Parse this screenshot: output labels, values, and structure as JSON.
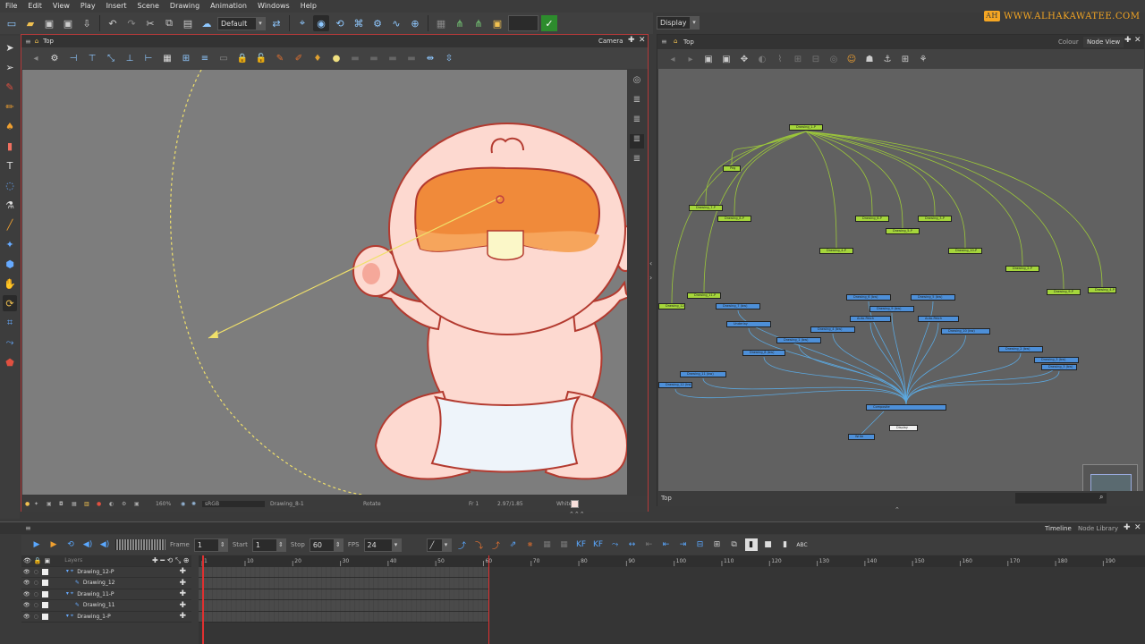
{
  "menu": [
    "File",
    "Edit",
    "View",
    "Play",
    "Insert",
    "Scene",
    "Drawing",
    "Animation",
    "Windows",
    "Help"
  ],
  "toolbar": {
    "workspace_combo": "Default",
    "display_combo": "Display"
  },
  "logo": {
    "text": "WWW.ALHAKAWATEE.COM",
    "icon": "AH"
  },
  "camera_view": {
    "tab_label": "Top",
    "view_name": "Camera",
    "status": {
      "zoom": "160%",
      "colorspace": "sRGB",
      "drawing": "Drawing_8-1",
      "tool": "Rotate",
      "frame": "Fr 1",
      "coords": "2.97/1.85",
      "bg": "White"
    }
  },
  "node_view": {
    "tab_label": "Top",
    "tabs": [
      "Colour",
      "Node View"
    ],
    "status_path": "Top",
    "nodes": [
      {
        "label": "Drawing_1-P",
        "type": "g"
      },
      {
        "label": "Peg",
        "type": "g"
      },
      {
        "label": "Drawing_7-P",
        "type": "g"
      },
      {
        "label": "Drawing_8-P",
        "type": "g"
      },
      {
        "label": "Drawing_6-P",
        "type": "g"
      },
      {
        "label": "Drawing_5-P",
        "type": "g"
      },
      {
        "label": "Drawing_3-P",
        "type": "g"
      },
      {
        "label": "Drawing_4-P",
        "type": "g"
      },
      {
        "label": "Drawing_10-P",
        "type": "g"
      },
      {
        "label": "Drawing_2-P",
        "type": "g"
      },
      {
        "label": "Drawing_11-P",
        "type": "g"
      },
      {
        "label": "Drawing_12-P",
        "type": "g"
      },
      {
        "label": "Drawing_9-P",
        "type": "g"
      },
      {
        "label": "Drawing_4-P",
        "type": "g"
      },
      {
        "label": "Drawing_7 (bw)",
        "type": "b"
      },
      {
        "label": "Drawing_6 (bw)",
        "type": "b"
      },
      {
        "label": "Drawing_5 (bw)",
        "type": "b"
      },
      {
        "label": "Drawing_1 (bw)",
        "type": "b"
      },
      {
        "label": "Drawing_9 (bw)",
        "type": "b"
      },
      {
        "label": "Drawing_4 (bw)",
        "type": "b"
      },
      {
        "label": "Drawing_10 (bw)",
        "type": "b"
      },
      {
        "label": "Drawing_2 (bw)",
        "type": "b"
      },
      {
        "label": "Drawing_3 (bw)",
        "type": "b"
      },
      {
        "label": "Drawing_11 (bw)",
        "type": "b"
      },
      {
        "label": "Drawing_12 (bw)",
        "type": "b"
      },
      {
        "label": "Drawing_8 (bw)",
        "type": "b"
      },
      {
        "label": "Underlay",
        "type": "b"
      },
      {
        "label": "Auto-Patch",
        "type": "b"
      },
      {
        "label": "Auto-Patch",
        "type": "b"
      },
      {
        "label": "Drawing_3 (bw)",
        "type": "b"
      },
      {
        "label": "Composite",
        "type": "b"
      },
      {
        "label": "Write",
        "type": "b"
      },
      {
        "label": "Display",
        "type": "w"
      }
    ]
  },
  "timeline": {
    "tabs": [
      "Timeline",
      "Node Library"
    ],
    "frame_label": "Frame",
    "frame_value": "1",
    "start_label": "Start",
    "start_value": "1",
    "stop_label": "Stop",
    "stop_value": "60",
    "fps_label": "FPS",
    "fps_value": "24",
    "layers_header": "Layers",
    "layers": [
      {
        "name": "Drawing_12-P",
        "indent": 1
      },
      {
        "name": "Drawing_12",
        "indent": 2
      },
      {
        "name": "Drawing_11-P",
        "indent": 1
      },
      {
        "name": "Drawing_11",
        "indent": 2
      },
      {
        "name": "Drawing_1-P",
        "indent": 1
      }
    ],
    "ruler": [
      "1",
      "10",
      "20",
      "30",
      "40",
      "50",
      "60",
      "70",
      "80",
      "90",
      "100",
      "110",
      "120",
      "130",
      "140",
      "150",
      "160",
      "170",
      "180",
      "190"
    ],
    "current_frame": 1,
    "stop_frame": 60,
    "kf_label": "KF"
  },
  "colors": {
    "accent": "#b53a3a",
    "peg_node": "#a5d63b",
    "draw_node": "#4d8fd8",
    "logo": "#f5a623",
    "skin": "#fdd9d0",
    "outline": "#b33a2f",
    "mouth": "#f08a3a"
  }
}
